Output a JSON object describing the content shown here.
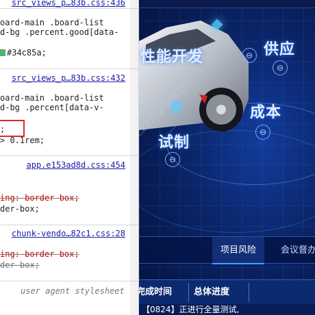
{
  "devtools": {
    "rules": [
      {
        "source": "src_views_p…83b.css:436",
        "lines": [
          "oard-main .board-list",
          "d-bg .percent.good[data-",
          "",
          "#34c85a;"
        ]
      },
      {
        "source": "src_views_p…83b.css:432",
        "lines": [
          "oard-main .board-list",
          "d-bg .percent[data-v-",
          "",
          ";",
          "> 0.1rem;"
        ]
      },
      {
        "source": "app.e153ad8d.css:454",
        "lines": [
          "ing: border-box;",
          "der-box;"
        ]
      },
      {
        "source": "chunk-vendo…82c1.css:28",
        "lines": [
          "ing: border-box;",
          "der-box;"
        ]
      }
    ],
    "user_agent_label": "user agent stylesheet",
    "swatch_color": "#34c85a"
  },
  "screen": {
    "tiles": [
      "性能开发",
      "供应",
      "成本",
      "试制"
    ],
    "tile_button_glyph": "⊖",
    "watermark": "C23772 546257",
    "tabs": [
      "项目风险",
      "会议督办"
    ],
    "table_headers": [
      "完成时间",
      "总体进度"
    ],
    "row_text": "【0824】正进行全量测试,"
  }
}
